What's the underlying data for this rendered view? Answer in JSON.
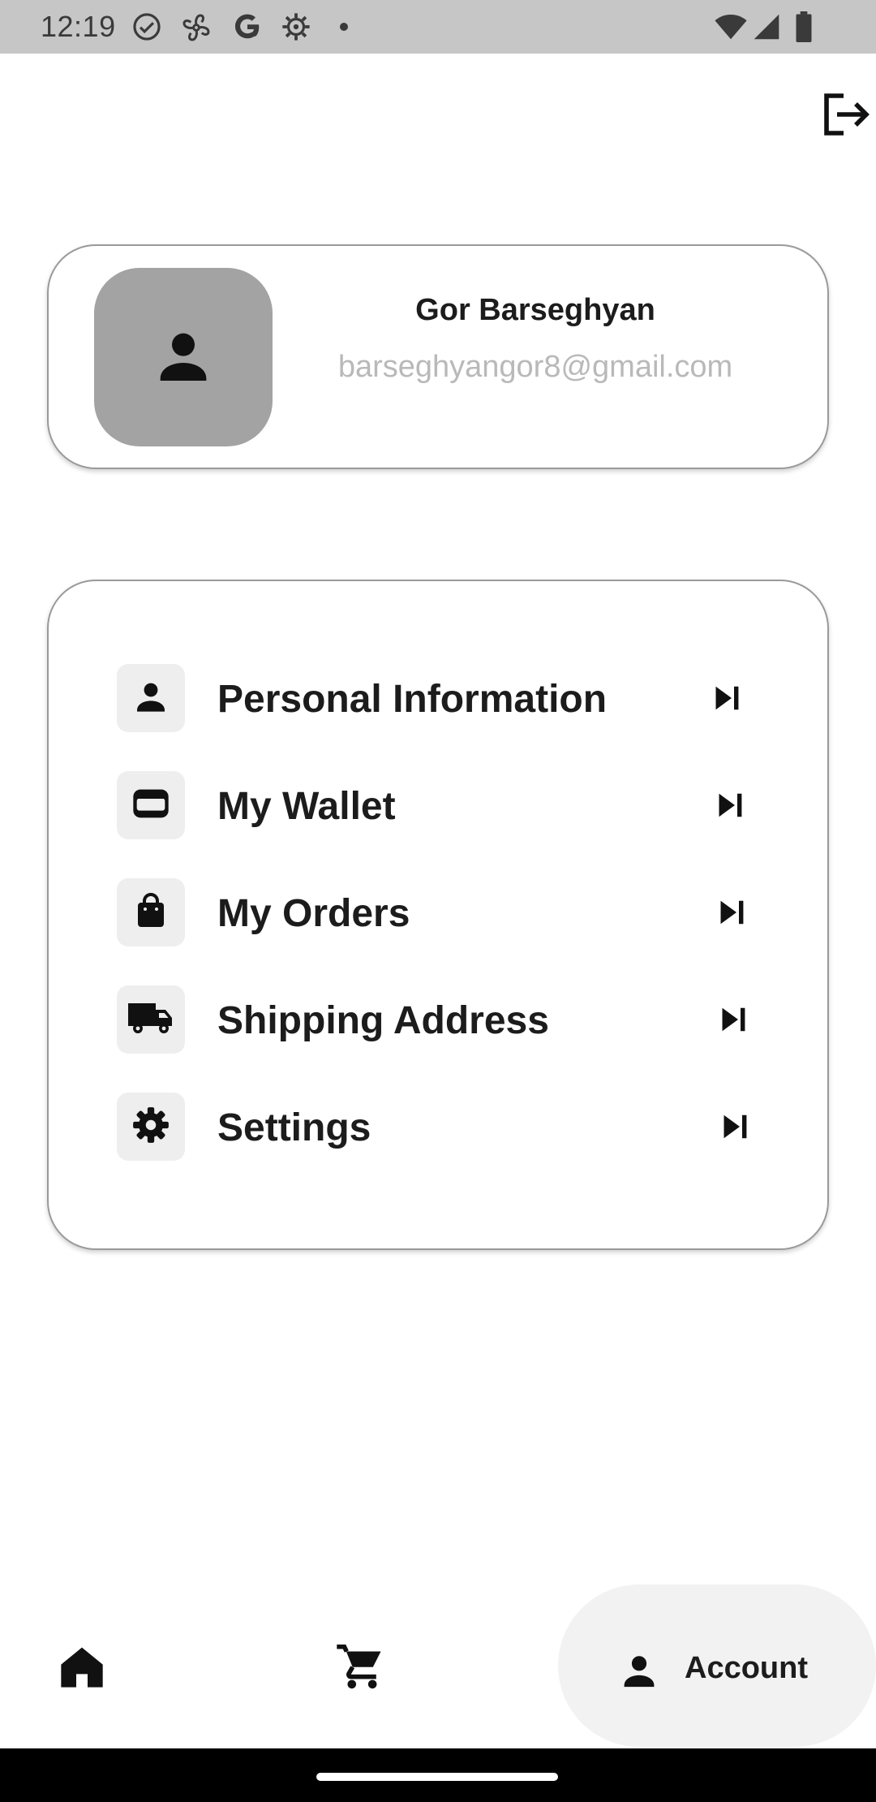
{
  "status_bar": {
    "time": "12:19",
    "left_icons": [
      "check-circle-icon",
      "fan-icon",
      "google-icon",
      "gear-icon",
      "dot-icon"
    ],
    "right_icons": [
      "wifi-icon",
      "signal-icon",
      "battery-icon"
    ]
  },
  "header": {
    "logout_icon": "logout-icon"
  },
  "profile": {
    "name": "Gor Barseghyan",
    "email": "barseghyangor8@gmail.com",
    "avatar_icon": "person-icon"
  },
  "menu": {
    "items": [
      {
        "label": "Personal Information",
        "icon": "person-icon"
      },
      {
        "label": "My Wallet",
        "icon": "wallet-icon"
      },
      {
        "label": "My Orders",
        "icon": "shopping-bag-icon"
      },
      {
        "label": "Shipping Address",
        "icon": "truck-icon"
      },
      {
        "label": "Settings",
        "icon": "gear-icon"
      }
    ],
    "chevron_icon": "skip-next-icon"
  },
  "bottom_nav": {
    "items": [
      {
        "icon": "home-icon"
      },
      {
        "icon": "cart-icon"
      },
      {
        "icon": "person-icon",
        "label": "Account",
        "selected": true
      }
    ]
  },
  "colors": {
    "status_bar": "#c6c6c6",
    "avatar_bg": "#a3a3a3",
    "email_text": "#b9b9b9",
    "icon_box_bg": "#eeeeee",
    "nav_selected_bg": "#f2f2f2"
  }
}
